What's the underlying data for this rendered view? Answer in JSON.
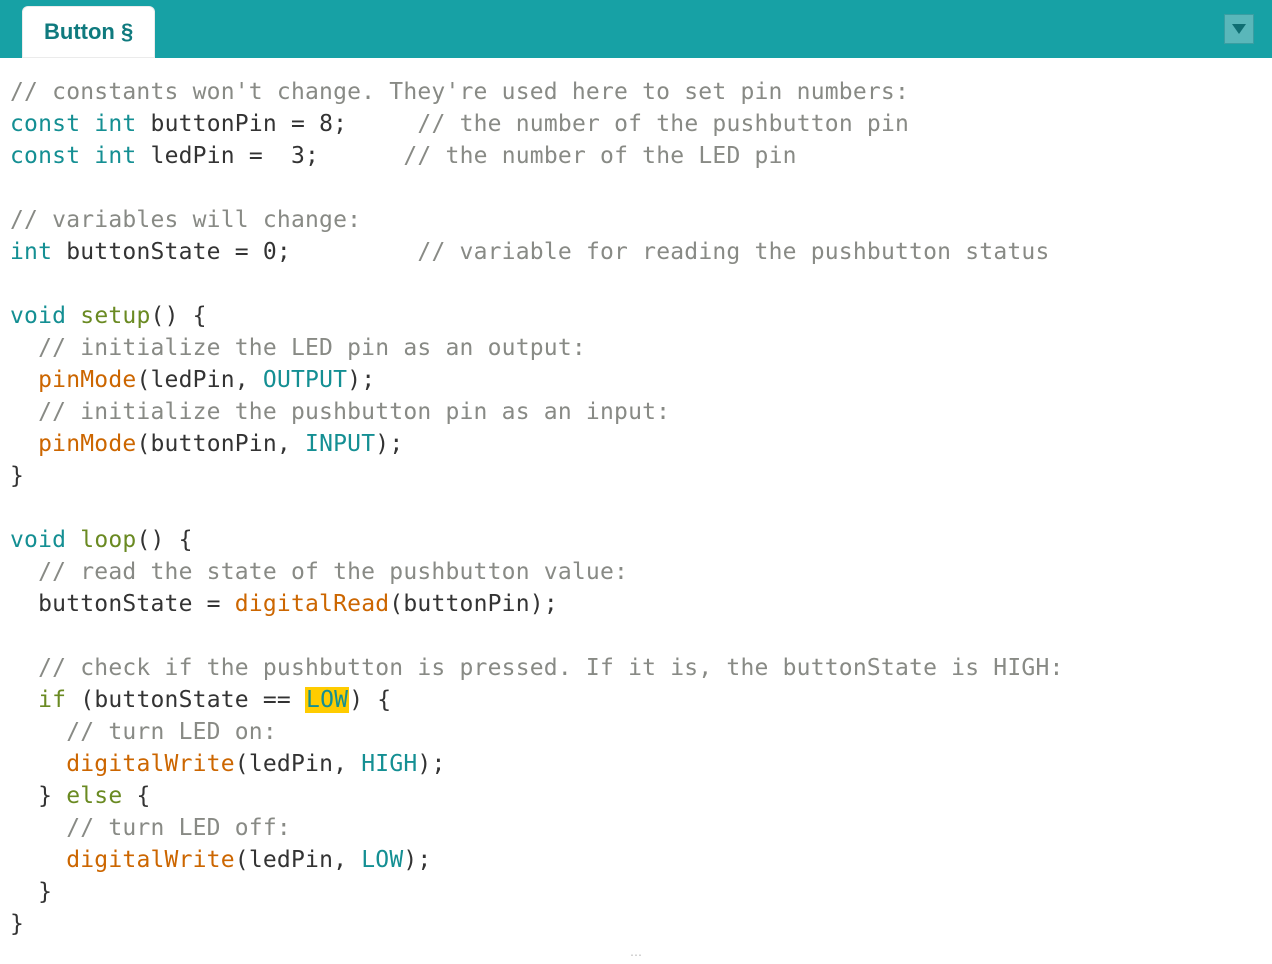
{
  "tab": {
    "label": "Button §"
  },
  "code": {
    "l01_comment": "// constants won't change. They're used here to set pin numbers:",
    "l02_kw1": "const",
    "l02_kw2": "int",
    "l02_rest": " buttonPin = 8;     ",
    "l02_c": "// the number of the pushbutton pin",
    "l03_kw1": "const",
    "l03_kw2": "int",
    "l03_rest": " ledPin =  3;      ",
    "l03_c": "// the number of the LED pin",
    "l05_comment": "// variables will change:",
    "l06_kw": "int",
    "l06_rest": " buttonState = 0;         ",
    "l06_c": "// variable for reading the pushbutton status",
    "l08_kw": "void",
    "l08_fn": "setup",
    "l08_rest": "() {",
    "l09_c": "  // initialize the LED pin as an output:",
    "l10_pre": "  ",
    "l10_fn": "pinMode",
    "l10_mid": "(ledPin, ",
    "l10_const": "OUTPUT",
    "l10_end": ");",
    "l11_c": "  // initialize the pushbutton pin as an input:",
    "l12_pre": "  ",
    "l12_fn": "pinMode",
    "l12_mid": "(buttonPin, ",
    "l12_const": "INPUT",
    "l12_end": ");",
    "l13": "}",
    "l15_kw": "void",
    "l15_fn": "loop",
    "l15_rest": "() {",
    "l16_c": "  // read the state of the pushbutton value:",
    "l17_pre": "  buttonState = ",
    "l17_fn": "digitalRead",
    "l17_end": "(buttonPin);",
    "l19_c": "  // check if the pushbutton is pressed. If it is, the buttonState is HIGH:",
    "l20_pre": "  ",
    "l20_kw": "if",
    "l20_mid": " (buttonState == ",
    "l20_low": "LOW",
    "l20_end": ") {",
    "l21_c": "    // turn LED on:",
    "l22_pre": "    ",
    "l22_fn": "digitalWrite",
    "l22_mid": "(ledPin, ",
    "l22_const": "HIGH",
    "l22_end": ");",
    "l23_pre": "  } ",
    "l23_kw": "else",
    "l23_end": " {",
    "l24_c": "    // turn LED off:",
    "l25_pre": "    ",
    "l25_fn": "digitalWrite",
    "l25_mid": "(ledPin, ",
    "l25_const": "LOW",
    "l25_end": ");",
    "l26": "  }",
    "l27": "}"
  }
}
